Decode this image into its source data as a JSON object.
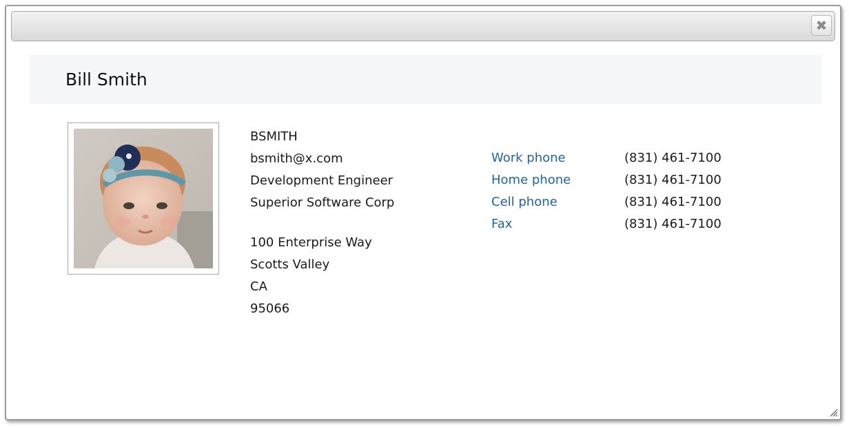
{
  "dialog": {
    "close_glyph": "✖"
  },
  "contact": {
    "name": "Bill Smith",
    "username": "BSMITH",
    "email": "bsmith@x.com",
    "job_title": "Development Engineer",
    "company": "Superior Software Corp",
    "address": {
      "street": "100 Enterprise Way",
      "city": "Scotts Valley",
      "state": "CA",
      "zip": "95066"
    },
    "phones": [
      {
        "label": "Work phone",
        "number": "(831) 461-7100"
      },
      {
        "label": "Home phone",
        "number": "(831) 461-7100"
      },
      {
        "label": "Cell phone",
        "number": "(831) 461-7100"
      },
      {
        "label": "Fax",
        "number": "(831) 461-7100"
      }
    ]
  },
  "colors": {
    "link": "#1f63a8",
    "header_band": "#f6f7fb",
    "titlebar_top": "#f1f1f1",
    "titlebar_bottom": "#dadada"
  },
  "icons": {
    "close": "close-icon",
    "resize": "resize-grip-icon",
    "photo": "contact-photo"
  }
}
